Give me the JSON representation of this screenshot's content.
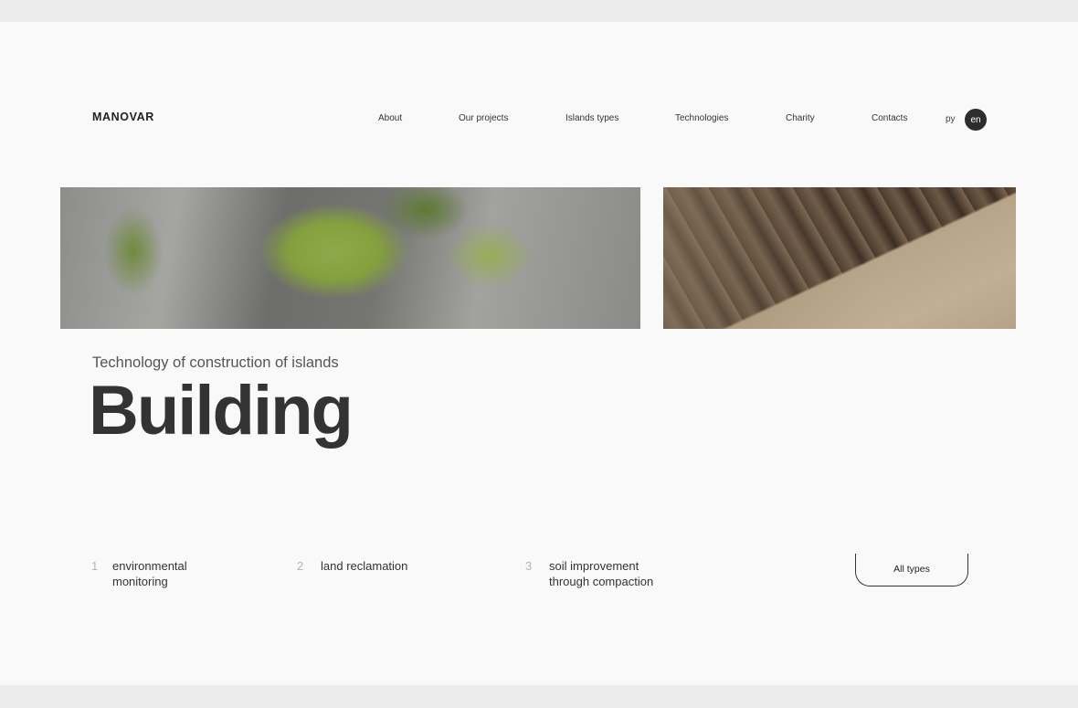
{
  "header": {
    "logo": "MANOVAR",
    "nav": [
      "About",
      "Our projects",
      "Islands types",
      "Technologies",
      "Charity",
      "Contacts"
    ],
    "lang_ru": "ру",
    "lang_en": "en"
  },
  "hero": {
    "subtitle": "Technology of construction of islands",
    "title": "Building"
  },
  "types": [
    {
      "num": "1",
      "label": "environmental monitoring"
    },
    {
      "num": "2",
      "label": "land reclamation"
    },
    {
      "num": "3",
      "label": "soil improvement through compaction"
    }
  ],
  "all_types_label": "All types"
}
